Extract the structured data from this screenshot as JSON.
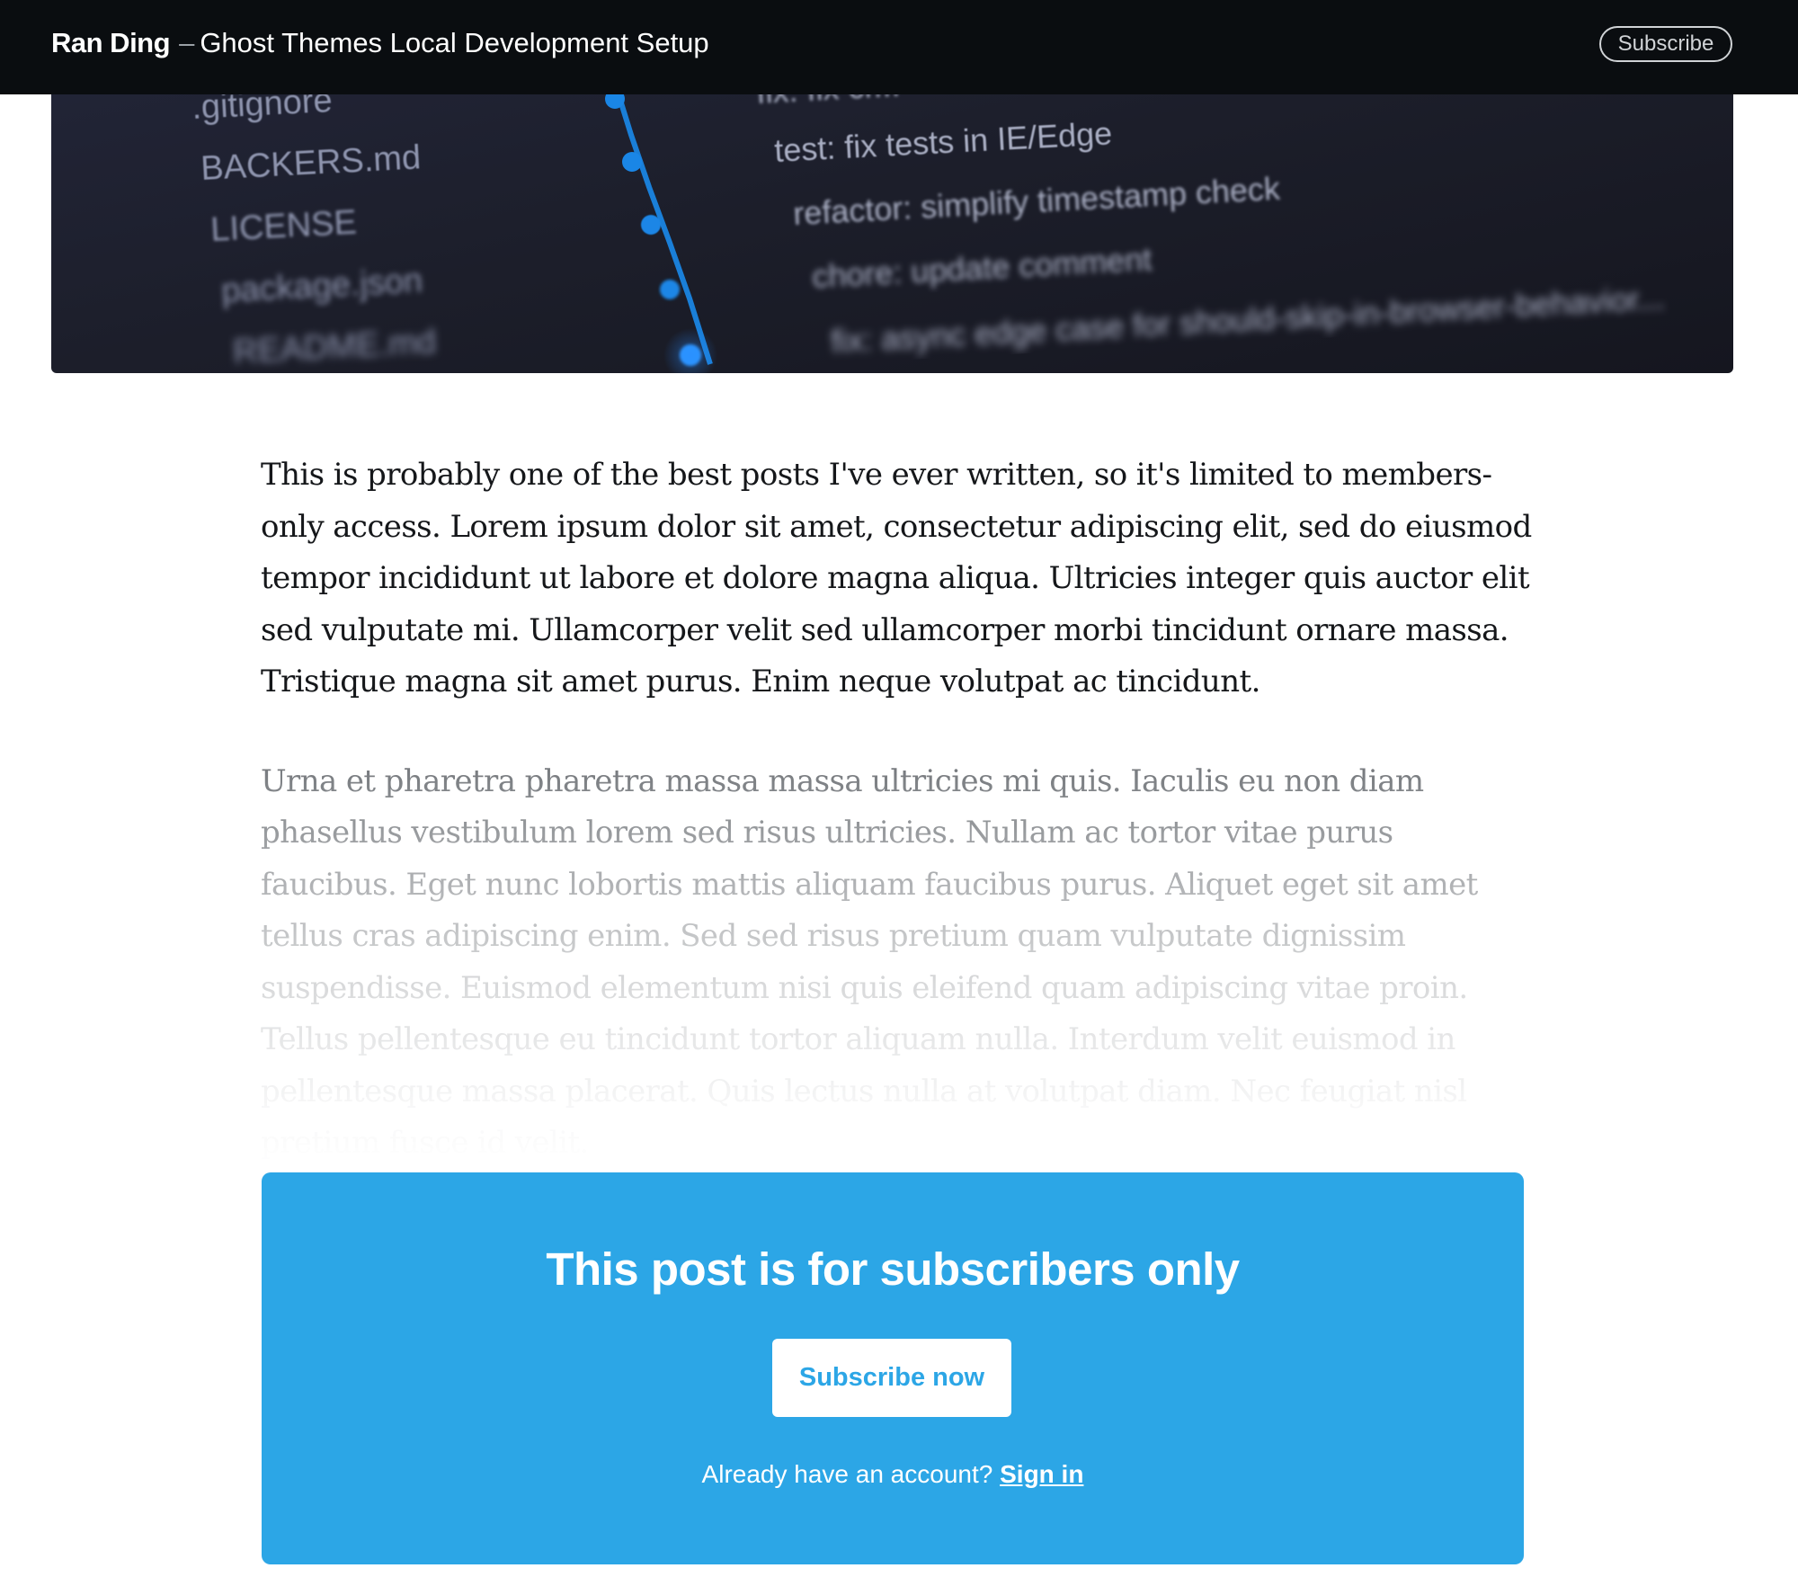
{
  "header": {
    "site_name": "Ran Ding",
    "separator": "–",
    "post_title": "Ghost Themes Local Development Setup",
    "subscribe_label": "Subscribe"
  },
  "feature_image": {
    "file_list": [
      ".gitignore",
      "BACKERS.md",
      "LICENSE",
      "package.json",
      "README.md"
    ],
    "commit_messages": [
      "fix: fix cr...",
      "test: fix tests in IE/Edge",
      "refactor: simplify timestamp check",
      "chore: update comment",
      "fix: async edge case for should-skip-in-browser-behavior..."
    ],
    "colors": {
      "background": "#1c1e2a",
      "text": "#9da4bd",
      "graph_line": "#1a7fd8"
    }
  },
  "article": {
    "paragraph_1": "This is probably one of the best posts I've ever written, so it's limited to members-only access. Lorem ipsum dolor sit amet, consectetur adipiscing elit, sed do eiusmod tempor incididunt ut labore et dolore magna aliqua. Ultricies integer quis auctor elit sed vulputate mi. Ullamcorper velit sed ullamcorper morbi tincidunt ornare massa. Tristique magna sit amet purus. Enim neque volutpat ac tincidunt.",
    "paragraph_2": "Urna et pharetra pharetra massa massa ultricies mi quis. Iaculis eu non diam phasellus vestibulum lorem sed risus ultricies. Nullam ac tortor vitae purus faucibus. Eget nunc lobortis mattis aliquam faucibus purus. Aliquet eget sit amet tellus cras adipiscing enim. Sed sed risus pretium quam vulputate dignissim suspendisse. Euismod elementum nisi quis eleifend quam adipiscing vitae proin. Tellus pellentesque eu tincidunt tortor aliquam nulla. Interdum velit euismod in pellentesque massa placerat. Quis lectus nulla at volutpat diam. Nec feugiat nisl pretium fusce id velit."
  },
  "paywall": {
    "heading": "This post is for subscribers only",
    "subscribe_button": "Subscribe now",
    "account_prompt": "Already have an account?",
    "sign_in_label": "Sign in",
    "colors": {
      "background": "#2ca6e6",
      "button_background": "#ffffff"
    }
  }
}
